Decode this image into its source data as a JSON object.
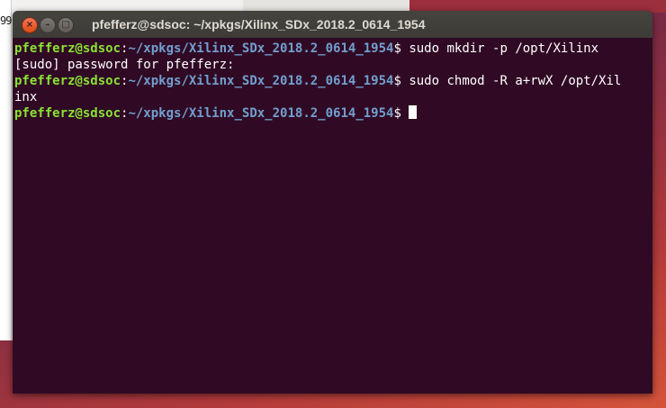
{
  "background": {
    "peek_text": "99"
  },
  "window": {
    "title": "pfefferz@sdsoc: ~/xpkgs/Xilinx_SDx_2018.2_0614_1954",
    "buttons": {
      "close": "×",
      "minimize": "–",
      "maximize": "□"
    }
  },
  "terminal": {
    "colors": {
      "background": "#300a24",
      "user": "#8ae234",
      "path": "#729fcf",
      "text": "#ffffff"
    },
    "lines": [
      {
        "user": "pfefferz@sdsoc",
        "sep": ":",
        "path": "~/xpkgs/Xilinx_SDx_2018.2_0614_1954",
        "cmd": "$ sudo mkdir -p /opt/Xilinx"
      },
      {
        "text": "[sudo] password for pfefferz:"
      },
      {
        "user": "pfefferz@sdsoc",
        "sep": ":",
        "path": "~/xpkgs/Xilinx_SDx_2018.2_0614_1954",
        "cmd": "$ sudo chmod -R a+rwX /opt/Xil"
      },
      {
        "text": "inx"
      },
      {
        "user": "pfefferz@sdsoc",
        "sep": ":",
        "path": "~/xpkgs/Xilinx_SDx_2018.2_0614_1954",
        "cmd": "$ "
      }
    ]
  }
}
